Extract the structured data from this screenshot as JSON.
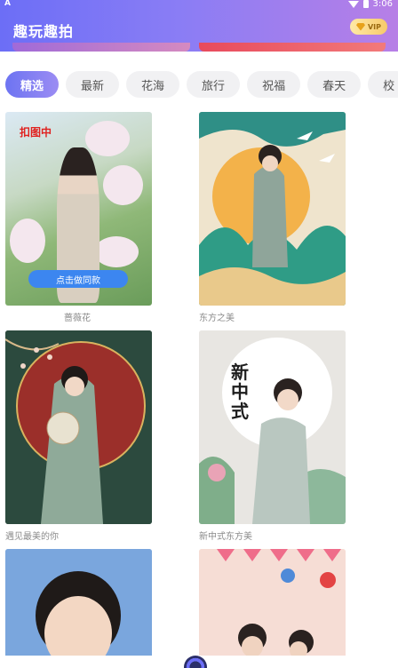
{
  "status_bar": {
    "time": "3:06",
    "left_icon": "A"
  },
  "header": {
    "title": "趣玩趣拍",
    "vip_label": "VIP"
  },
  "tabs": [
    {
      "label": "精选",
      "active": true
    },
    {
      "label": "最新"
    },
    {
      "label": "花海"
    },
    {
      "label": "旅行"
    },
    {
      "label": "祝福"
    },
    {
      "label": "春天"
    },
    {
      "label": "校"
    }
  ],
  "cards": [
    {
      "caption": "蔷薇花",
      "badge": "扣图中",
      "action": "点击做同款"
    },
    {
      "caption": "东方之美"
    },
    {
      "caption": "遇见最美的你"
    },
    {
      "caption": "新中式东方美",
      "art_text": "新中式"
    },
    {
      "caption": ""
    },
    {
      "caption": ""
    }
  ],
  "colors": {
    "accent": "#6c6ef6",
    "badge": "#e0211f",
    "action": "#3c86f0"
  }
}
